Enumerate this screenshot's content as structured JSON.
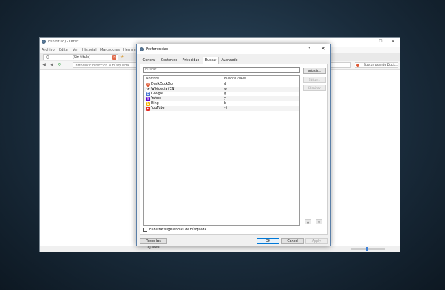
{
  "browser": {
    "title": "(Sin título) - Otter",
    "menu": [
      "Archivo",
      "Editar",
      "Ver",
      "Historial",
      "Marcadores",
      "Herram"
    ],
    "tab_label": "(Sin título)",
    "url_placeholder": "Introducir dirección o búsqueda...",
    "search_placeholder": "Buscar usando Duck..."
  },
  "dialog": {
    "title": "Preferencias",
    "help": "?",
    "close": "✕",
    "tabs": [
      {
        "label": "General"
      },
      {
        "label": "Contenido"
      },
      {
        "label": "Privacidad"
      },
      {
        "label": "Buscar"
      },
      {
        "label": "Avanzado"
      }
    ],
    "active_tab": "Buscar",
    "search_placeholder": "Buscar ...",
    "columns": [
      "Nombre",
      "Palabra clave"
    ],
    "engines": [
      {
        "name": "DuckDuckGo",
        "keyword": "d",
        "icon": "duckduckgo-icon",
        "glyph": "D",
        "color": "#de5833"
      },
      {
        "name": "Wikipedia (EN)",
        "keyword": "w",
        "icon": "wikipedia-icon",
        "glyph": "W",
        "color": "#444444"
      },
      {
        "name": "Google",
        "keyword": "g",
        "icon": "google-icon",
        "glyph": "G",
        "color": "#4a78d0"
      },
      {
        "name": "Yahoo",
        "keyword": "y",
        "icon": "yahoo-icon",
        "glyph": "Y",
        "color": "#5f01d1"
      },
      {
        "name": "Bing",
        "keyword": "b",
        "icon": "bing-icon",
        "glyph": "b",
        "color": "#f4b400"
      },
      {
        "name": "YouTube",
        "keyword": "yt",
        "icon": "youtube-icon",
        "glyph": "▶",
        "color": "#e52d27"
      }
    ],
    "buttons": {
      "add": "Añadir...",
      "edit": "Editar...",
      "remove": "Eliminar",
      "move_up": "▲",
      "move_down": "▼"
    },
    "suggestions_label": "Habilitar sugerencias de búsqueda",
    "footer": {
      "all_settings": "Todos los ajustes",
      "ok": "OK",
      "cancel": "Cancel",
      "apply": "Apply"
    }
  }
}
